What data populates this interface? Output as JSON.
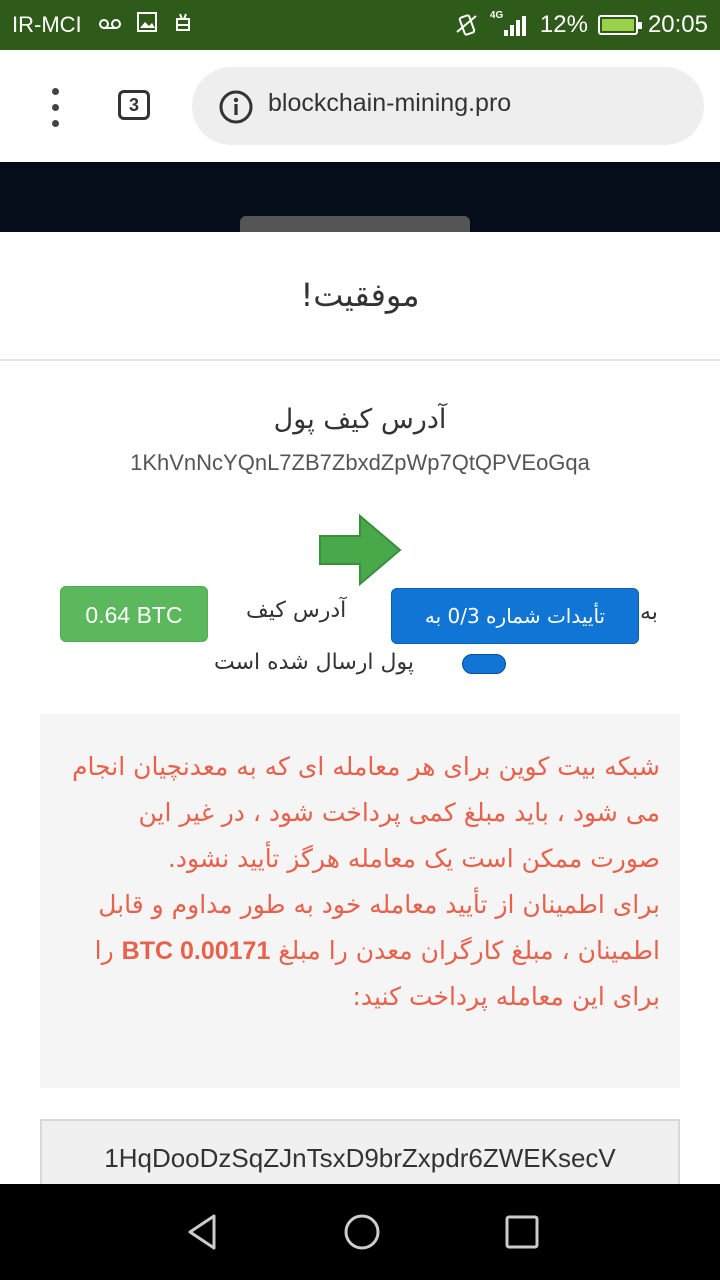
{
  "status_bar": {
    "carrier": "IR-MCI",
    "network": "4G",
    "battery": "12%",
    "time": "20:05"
  },
  "browser": {
    "tab_count": "3",
    "url": "blockchain-mining.pro"
  },
  "modal": {
    "title": "!موفقیت",
    "wallet_label": "آدرس کیف پول",
    "wallet_address": "1KhVnNcYQnL7ZB7ZbxdZpWp7QtQPVEoGqa",
    "amount": "0.64 BTC",
    "to_address_label": "آدرس کیف",
    "confirm_button": "تأییدات شماره 0/3 به",
    "to_word": "به",
    "sent_label": "پول ارسال شده است",
    "notice_p1": "شبکه بیت کوین برای هر معامله ای که به معدنچیان انجام می شود ، باید مبلغ کمی پرداخت شود ، در غیر این صورت ممکن است یک معامله هرگز تأیید نشود.",
    "notice_p2_a": "برای اطمینان از تأیید معامله خود به طور مداوم و قابل اطمینان ، مبلغ کارگران معدن را مبلغ ",
    "notice_fee": "0.00171 BTC",
    "notice_p2_b": " را برای این معامله پرداخت کنید:",
    "deposit_address": "1HqDooDzSqZJnTsxD9brZxpdr6ZWEKsecV"
  },
  "colors": {
    "status_bar": "#2e5b1a",
    "success_green": "#5cb85c",
    "primary_blue": "#1175d6",
    "notice_red": "#e8614b",
    "arrow_green": "#49a84a"
  }
}
